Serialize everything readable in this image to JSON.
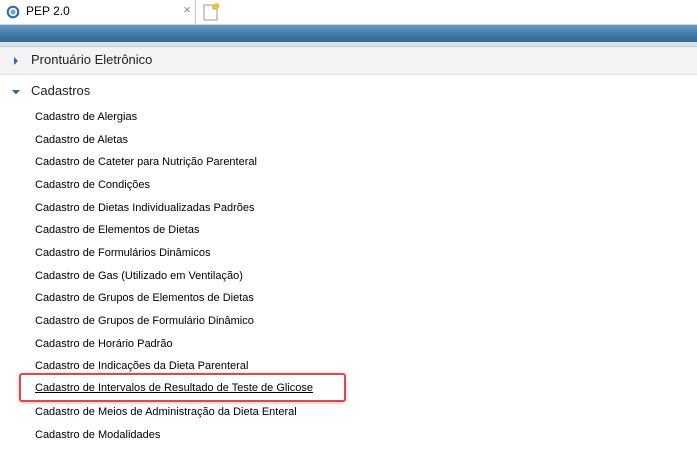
{
  "tab": {
    "title": "PEP 2.0",
    "close_glyph": "×",
    "icon": "app-logo-icon",
    "newtab_icon": "new-tab-icon"
  },
  "sections": [
    {
      "label": "Prontuário Eletrônico",
      "expanded": false
    },
    {
      "label": "Cadastros",
      "expanded": true
    }
  ],
  "items": [
    "Cadastro de Alergias",
    "Cadastro de Aletas",
    "Cadastro de Cateter para Nutrição Parenteral",
    "Cadastro de Condições",
    "Cadastro de Dietas Individualizadas Padrões",
    "Cadastro de Elementos de Dietas",
    "Cadastro de Formulários Dinâmicos",
    "Cadastro de Gas (Utilizado em Ventilação)",
    "Cadastro de Grupos de Elementos de Dietas",
    "Cadastro de Grupos de Formulário Dinâmico",
    "Cadastro de Horário Padrão",
    "Cadastro de Indicações da Dieta Parenteral",
    "Cadastro de Intervalos de Resultado de Teste de Glicose",
    "Cadastro de Meios de Administração da Dieta Enteral",
    "Cadastro de Modalidades"
  ],
  "active_item_index": 12,
  "colors": {
    "banner": "#3f77a3",
    "highlight": "#e0474c"
  }
}
